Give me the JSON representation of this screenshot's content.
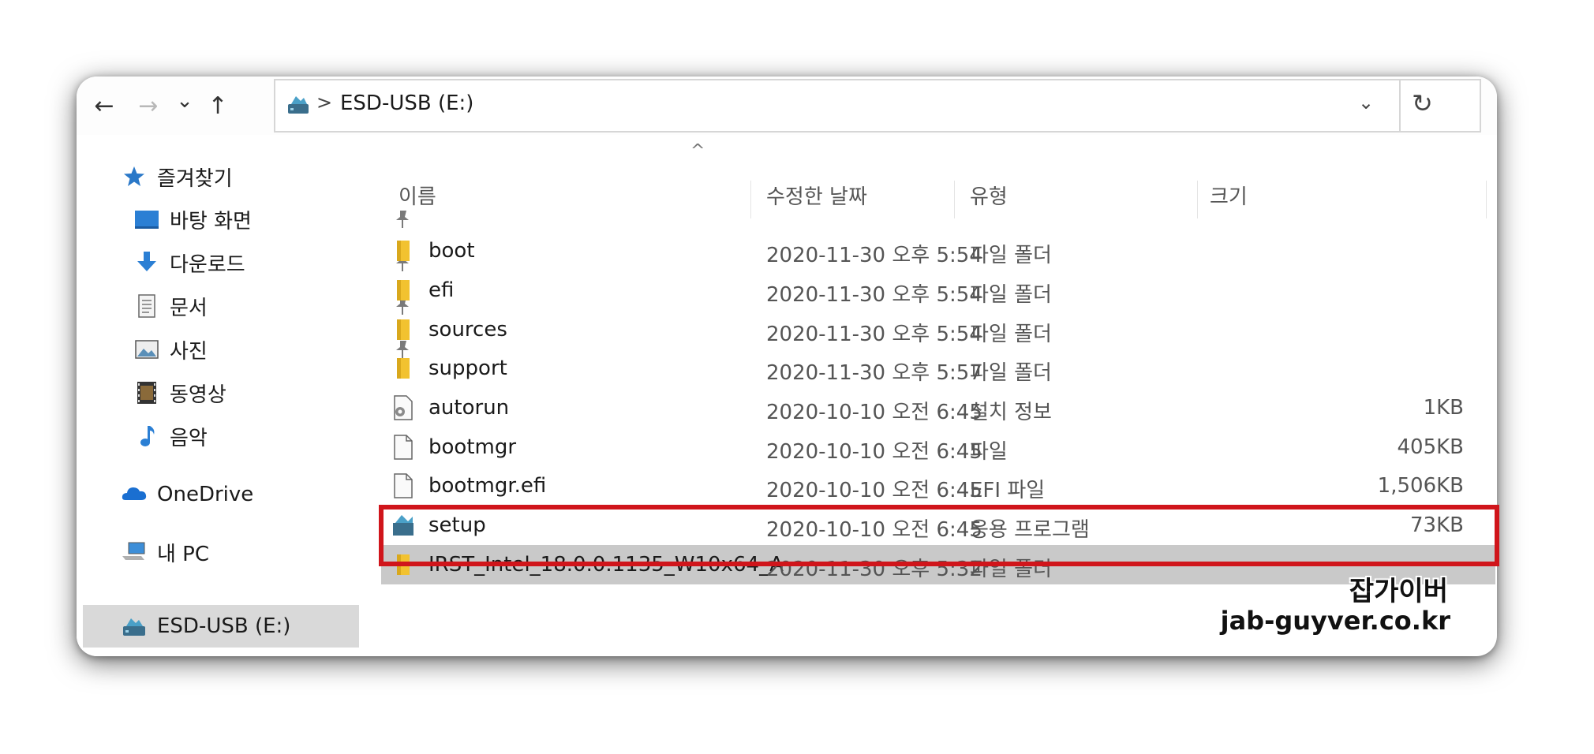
{
  "nav": {
    "back_icon": "arrow-left-icon",
    "forward_icon": "arrow-right-icon",
    "recent_icon": "chevron-down-icon",
    "up_icon": "arrow-up-icon",
    "back_glyph": "←",
    "forward_glyph": "→",
    "recent_glyph": "⌄",
    "up_glyph": "↑"
  },
  "address": {
    "separator": ">",
    "path": "ESD-USB (E:)",
    "dropdown_glyph": "⌄",
    "refresh_glyph": "↻"
  },
  "sidebar": {
    "quick_access": "즐겨찾기",
    "items": [
      {
        "label": "바탕 화면",
        "icon": "desktop-icon",
        "pinned": true
      },
      {
        "label": "다운로드",
        "icon": "download-icon",
        "pinned": true
      },
      {
        "label": "문서",
        "icon": "document-icon",
        "pinned": true
      },
      {
        "label": "사진",
        "icon": "pictures-icon",
        "pinned": true
      },
      {
        "label": "동영상",
        "icon": "video-icon",
        "pinned": false
      },
      {
        "label": "음악",
        "icon": "music-icon",
        "pinned": false
      }
    ],
    "onedrive": "OneDrive",
    "this_pc": "내 PC",
    "drive": "ESD-USB (E:)"
  },
  "columns": {
    "sort_glyph": "^",
    "name": "이름",
    "date": "수정한 날짜",
    "type": "유형",
    "size": "크기"
  },
  "files": [
    {
      "name": "boot",
      "date": "2020-11-30 오후 5:54",
      "type": "파일 폴더",
      "size": "",
      "icon": "folder-icon"
    },
    {
      "name": "efi",
      "date": "2020-11-30 오후 5:54",
      "type": "파일 폴더",
      "size": "",
      "icon": "folder-icon"
    },
    {
      "name": "sources",
      "date": "2020-11-30 오후 5:54",
      "type": "파일 폴더",
      "size": "",
      "icon": "folder-icon"
    },
    {
      "name": "support",
      "date": "2020-11-30 오후 5:57",
      "type": "파일 폴더",
      "size": "",
      "icon": "folder-icon"
    },
    {
      "name": "autorun",
      "date": "2020-10-10 오전 6:45",
      "type": "설치 정보",
      "size": "1KB",
      "icon": "setup-info-icon"
    },
    {
      "name": "bootmgr",
      "date": "2020-10-10 오전 6:45",
      "type": "파일",
      "size": "405KB",
      "icon": "file-icon"
    },
    {
      "name": "bootmgr.efi",
      "date": "2020-10-10 오전 6:45",
      "type": "EFI 파일",
      "size": "1,506KB",
      "icon": "file-icon"
    },
    {
      "name": "setup",
      "date": "2020-10-10 오전 6:45",
      "type": "응용 프로그램",
      "size": "73KB",
      "icon": "setup-app-icon"
    },
    {
      "name": "IRST_Intel_18.0.0.1135_W10x64_A",
      "date": "2020-11-30 오후 5:32",
      "type": "파일 폴더",
      "size": "",
      "icon": "folder-icon"
    }
  ],
  "colors": {
    "highlight_border": "#d0151b",
    "selected_row": "#c9c9c9",
    "folder": "#f2c230"
  },
  "watermark": {
    "line1": "잡가이버",
    "line2": "jab-guyver.co.kr"
  }
}
